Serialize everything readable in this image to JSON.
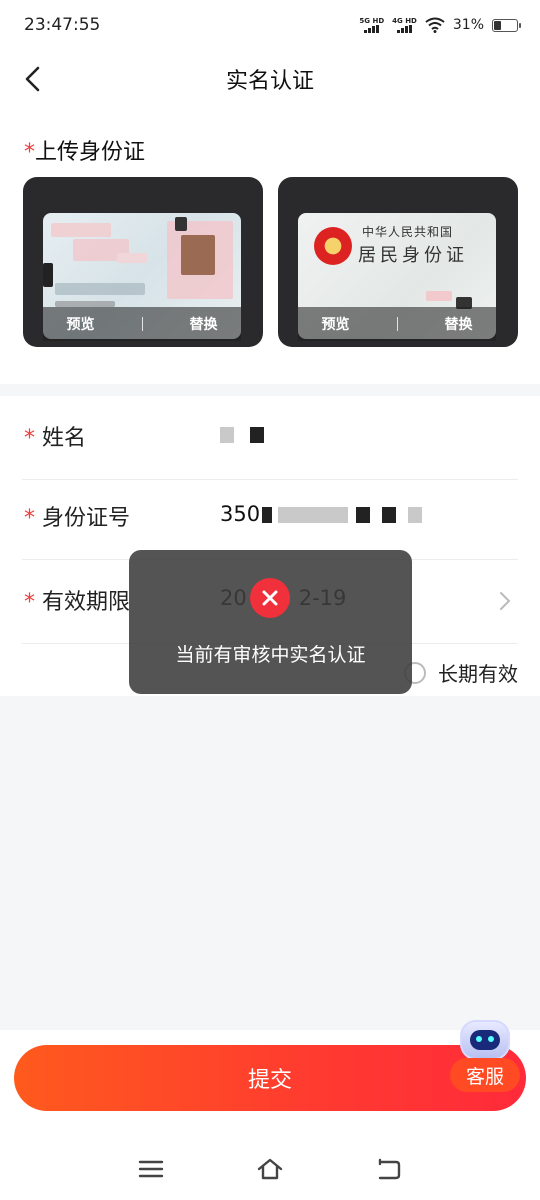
{
  "status_bar": {
    "time": "23:47:55",
    "signal_1": "5G HD",
    "signal_2": "4G HD",
    "battery": "31%",
    "battery_level": 0.31
  },
  "navbar": {
    "title": "实名认证",
    "back_icon": "chevron-left-icon"
  },
  "upload": {
    "required_mark": "*",
    "title": "上传身份证",
    "front_card": {
      "preview_label": "预览",
      "replace_label": "替换"
    },
    "back_card": {
      "country_text": "中华人民共和国",
      "card_title": "居民身份证",
      "preview_label": "预览",
      "replace_label": "替换"
    }
  },
  "form": {
    "name": {
      "required_mark": "*",
      "label": "姓名"
    },
    "id_number": {
      "required_mark": "*",
      "label": "身份证号",
      "value_prefix": "350"
    },
    "validity": {
      "required_mark": "*",
      "label": "有效期限",
      "value_start": "20",
      "value_end": "2-19"
    },
    "long_term": {
      "label": "长期有效",
      "checked": false
    }
  },
  "toast": {
    "message": "当前有审核中实名认证",
    "icon": "close-circle-icon",
    "color": "#f0303a"
  },
  "submit": {
    "label": "提交",
    "color": "#ff3a30"
  },
  "customer_service": {
    "label": "客服",
    "icon": "robot-icon"
  },
  "system_nav": {
    "menu_icon": "menu-icon",
    "home_icon": "home-icon",
    "back_icon": "back-icon"
  }
}
